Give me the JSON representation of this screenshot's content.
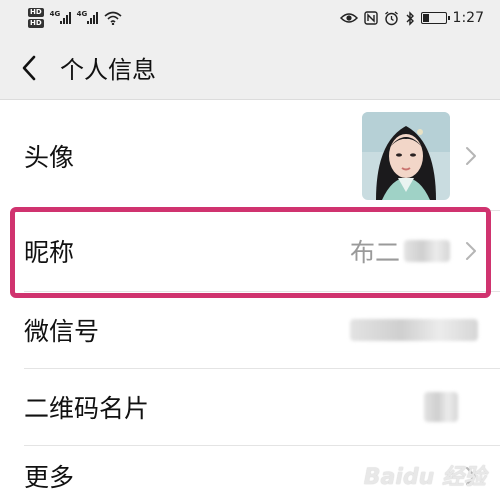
{
  "status_bar": {
    "time": "1:27",
    "network_1": "4G",
    "network_2": "4G",
    "hd_badge": "HD",
    "battery_level": 0.3
  },
  "header": {
    "title": "个人信息"
  },
  "rows": {
    "avatar": {
      "label": "头像"
    },
    "nickname": {
      "label": "昵称",
      "value": "布二"
    },
    "wechat_id": {
      "label": "微信号"
    },
    "qr_card": {
      "label": "二维码名片"
    },
    "more": {
      "label": "更多"
    }
  },
  "watermark": {
    "text": "Baidu 经验"
  },
  "colors": {
    "highlight": "#d0336f",
    "bar_bg": "#efefef"
  }
}
